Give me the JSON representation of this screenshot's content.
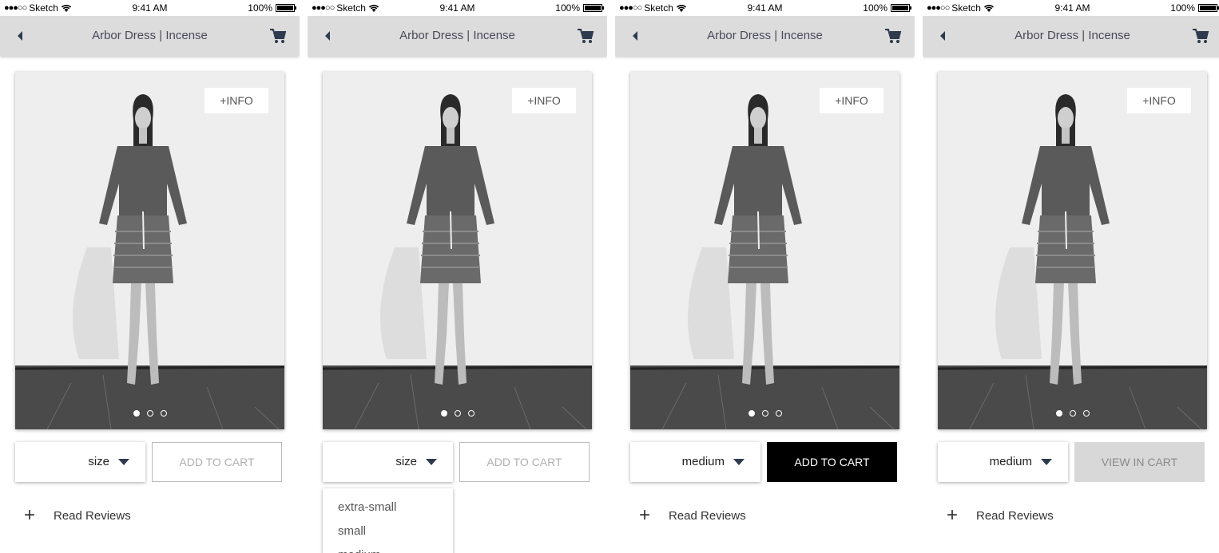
{
  "status_bar": {
    "carrier": "Sketch",
    "signal": "●●●○○",
    "time": "9:41 AM",
    "battery": "100%"
  },
  "nav": {
    "title": "Arbor Dress | Incense"
  },
  "product": {
    "info_label": "+INFO",
    "carousel_total": 3,
    "carousel_active": 1
  },
  "reviews_label": "Read Reviews",
  "screens": [
    {
      "size_label": "size",
      "action_label": "ADD TO CART"
    },
    {
      "size_label": "size",
      "action_label": "ADD TO CART",
      "dropdown": {
        "options": [
          "extra-small",
          "small",
          "medium"
        ]
      }
    },
    {
      "size_label": "medium",
      "action_label": "ADD TO CART"
    },
    {
      "size_label": "medium",
      "action_label": "VIEW IN CART"
    }
  ],
  "colors": {
    "nav_bg": "#dcdcdc",
    "accent": "#2e3a4e",
    "primary_button": "#000000",
    "disabled_button": "#d8d8d8"
  }
}
